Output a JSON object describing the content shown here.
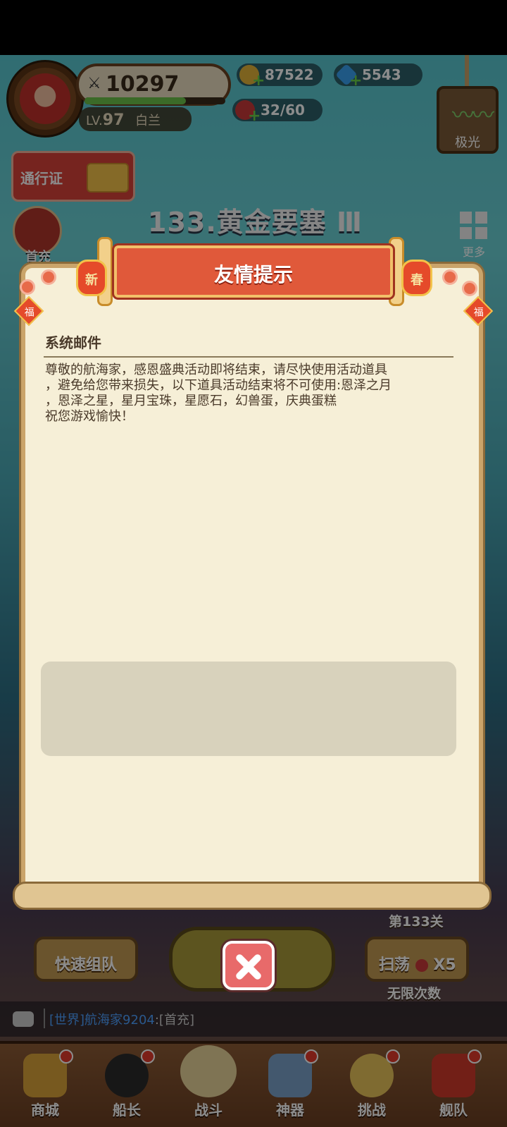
{
  "player": {
    "power": "10297",
    "level_prefix": "LV.",
    "level": "97",
    "name": "白兰",
    "exp_progress": 0.72
  },
  "resources": {
    "gold": "87522",
    "diamonds": "5543",
    "stamina": "32/60"
  },
  "aurora_label": "极光",
  "pass_label": "通行证",
  "stage_title": "133.黄金要塞 Ⅲ",
  "more_label": "更多",
  "side": {
    "first_recharge": "首充"
  },
  "modal": {
    "title": "友情提示",
    "lantern_left": "新",
    "lantern_right": "春",
    "fu": "福",
    "subject": "系统邮件",
    "content": "尊敬的航海家，感恩盛典活动即将结束，请尽快使用活动道具\n，避免给您带来损失，以下道具活动结束将不可使用:恩泽之月\n，恩泽之星，星月宝珠，星愿石，幻兽蛋，庆典蛋糕\n祝您游戏愉快！"
  },
  "controls": {
    "quick_team": "快速组队",
    "stage_number": "第133关",
    "sweep": "扫荡",
    "sweep_count": "X5",
    "unlimited": "无限次数"
  },
  "chat": {
    "channel": "[世界]",
    "sender": "航海家9204",
    "message": ":[首充]"
  },
  "tabs": [
    {
      "label": "商城"
    },
    {
      "label": "船长"
    },
    {
      "label": "战斗"
    },
    {
      "label": "神器"
    },
    {
      "label": "挑战"
    },
    {
      "label": "舰队"
    }
  ],
  "colors": {
    "accent_red": "#e0593a",
    "paper": "#f6efd7",
    "tab_bar": "#8c5b35"
  }
}
